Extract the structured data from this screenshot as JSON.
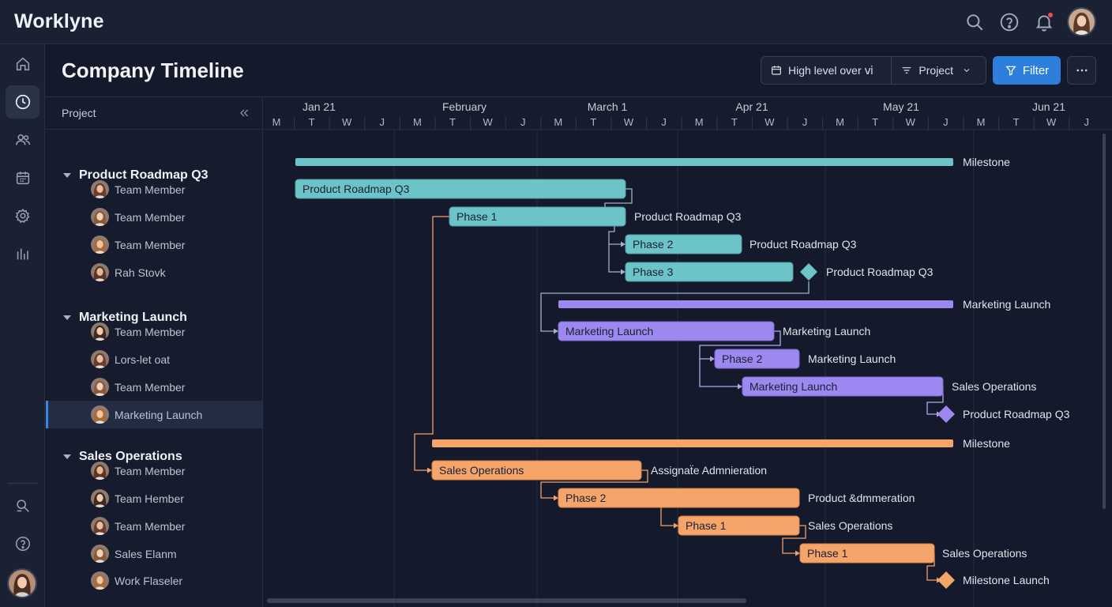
{
  "app": {
    "brand": "Worklyne"
  },
  "topbar": {
    "icons": [
      "search-icon",
      "help-icon",
      "bell-icon"
    ],
    "notification_dot_color": "#ef4b4b"
  },
  "rail": {
    "items": [
      "home-icon",
      "clock-icon",
      "users-icon",
      "calendar-icon",
      "settings-icon",
      "analytics-icon",
      "search-tool-icon",
      "help-circle-icon"
    ],
    "active": "clock-icon"
  },
  "page": {
    "title": "Company Timeline"
  },
  "toolbar": {
    "view_label": "High level over ⅵ",
    "group_label": "Project",
    "filter_label": "Filter",
    "more_label": "⋯"
  },
  "panel": {
    "header": "Project",
    "groups": [
      {
        "name": "Product Roadmap Q3",
        "members": [
          "Team Member",
          "Team Member",
          "Team Member",
          "Rah Stovk"
        ]
      },
      {
        "name": "Marketing Launch",
        "members": [
          "Team Member",
          "Lors-let oat",
          "Team Member",
          "Marketing Launch"
        ]
      },
      {
        "name": "Sales Operations",
        "members": [
          "Team Member",
          "Team Hember",
          "Team Member",
          "Sales Elanm",
          "Work Flaseler"
        ]
      }
    ],
    "selected_member": "Marketing Launch"
  },
  "timeline": {
    "months": [
      "Jan 21",
      "February",
      "March 1",
      "Apr 21",
      "May 21",
      "Jun 21"
    ],
    "day_letters": [
      "M",
      "T",
      "W",
      "J"
    ]
  },
  "colors": {
    "teal": "#6cc3c8",
    "purple": "#9c88ef",
    "orange": "#f5a46a",
    "accent": "#2d7fdb"
  },
  "gantt": {
    "rows": [
      {
        "kind": "summary",
        "color": "teal",
        "label": "Milestone"
      },
      {
        "kind": "bar",
        "color": "teal",
        "text": "Product Roadmap Q3",
        "label": ""
      },
      {
        "kind": "bar",
        "color": "teal",
        "text": "Phase 1",
        "label": "Product Roadmap Q3"
      },
      {
        "kind": "bar",
        "color": "teal",
        "text": "Phase 2",
        "label": "Product Roadmap Q3"
      },
      {
        "kind": "bar",
        "color": "teal",
        "text": "Phase 3",
        "label": "Product Roadmap Q3",
        "milestone": true
      },
      {
        "kind": "summary",
        "color": "purple",
        "label": "Marketing Launch"
      },
      {
        "kind": "bar",
        "color": "purple",
        "text": "Marketing Launch",
        "label": "Marketing Launch"
      },
      {
        "kind": "bar",
        "color": "purple",
        "text": "Phase 2",
        "label": "Marketing Launch"
      },
      {
        "kind": "bar",
        "color": "purple",
        "text": "Marketing Launch",
        "label": "Sales Operations"
      },
      {
        "kind": "diamond",
        "color": "purple",
        "label": "Product Roadmap Q3"
      },
      {
        "kind": "summary",
        "color": "orange",
        "label": "Milestone"
      },
      {
        "kind": "bar",
        "color": "orange",
        "text": "Sales Operations",
        "label": "Assignaẗe Admnieration"
      },
      {
        "kind": "bar",
        "color": "orange",
        "text": "Phase 2",
        "label": "Product &dmmeration"
      },
      {
        "kind": "bar",
        "color": "orange",
        "text": "Phase 1",
        "label": "Sales Operations"
      },
      {
        "kind": "bar",
        "color": "orange",
        "text": "Phase 1",
        "label": "Sales Operations"
      },
      {
        "kind": "diamond",
        "color": "orange",
        "label": "Milestone Launch"
      }
    ]
  }
}
